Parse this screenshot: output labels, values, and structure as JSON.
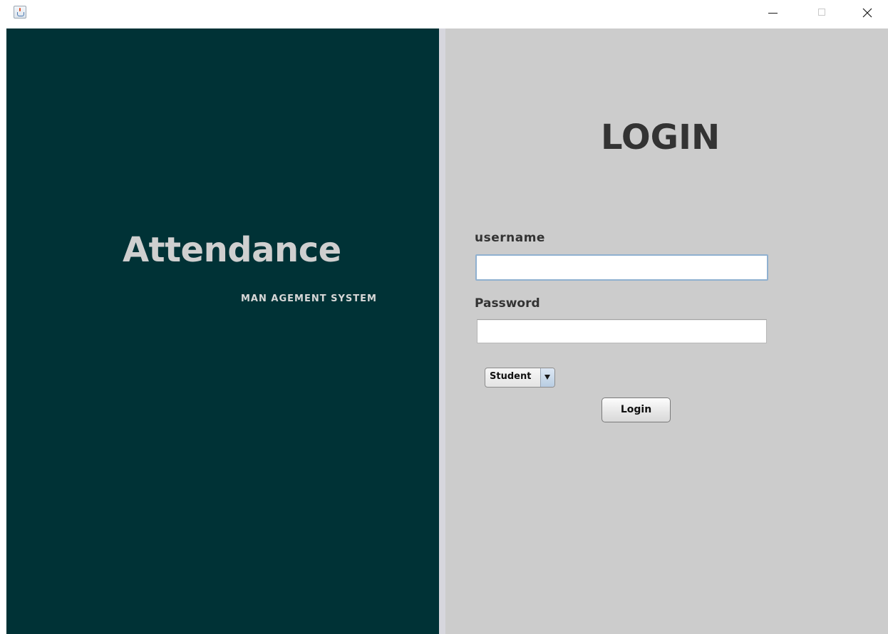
{
  "window": {
    "icon": "java-cup-icon",
    "controls": [
      "minimize-icon",
      "maximize-icon",
      "close-icon"
    ]
  },
  "branding": {
    "title": "Attendance",
    "subtitle": "MAN AGEMENT SYSTEM",
    "panel_color": "#003236"
  },
  "login": {
    "heading": "LOGIN",
    "username_label": "username",
    "username_value": "",
    "password_label": "Password",
    "password_value": "",
    "role_selected": "Student",
    "submit_label": "Login",
    "panel_color": "#cccccc"
  }
}
